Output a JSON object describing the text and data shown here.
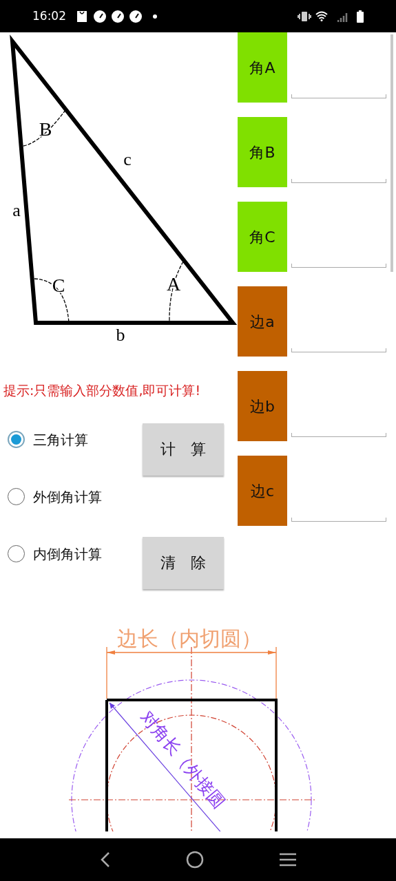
{
  "status_bar": {
    "time": "16:02"
  },
  "triangle": {
    "labels": [
      {
        "text": "B",
        "kind": "angle"
      },
      {
        "text": "c",
        "kind": "side"
      },
      {
        "text": "a",
        "kind": "side"
      },
      {
        "text": "C",
        "kind": "angle"
      },
      {
        "text": "A",
        "kind": "angle"
      },
      {
        "text": "b",
        "kind": "side"
      }
    ]
  },
  "hint": "提示:只需输入部分数值,即可计算!",
  "modes": [
    {
      "label": "三角计算",
      "selected": true
    },
    {
      "label": "外倒角计算",
      "selected": false
    },
    {
      "label": "内倒角计算",
      "selected": false
    }
  ],
  "buttons": [
    {
      "label": "计　算"
    },
    {
      "label": "清　除"
    }
  ],
  "inputs": [
    {
      "label": "角A",
      "kind": "angle"
    },
    {
      "label": "角B",
      "kind": "angle"
    },
    {
      "label": "角C",
      "kind": "angle"
    },
    {
      "label": "边a",
      "kind": "side"
    },
    {
      "label": "边b",
      "kind": "side"
    },
    {
      "label": "边c",
      "kind": "side"
    }
  ],
  "square_diagram": {
    "side_label": "边长（内切圆）",
    "diagonal_label": "对角长（外接圆"
  }
}
